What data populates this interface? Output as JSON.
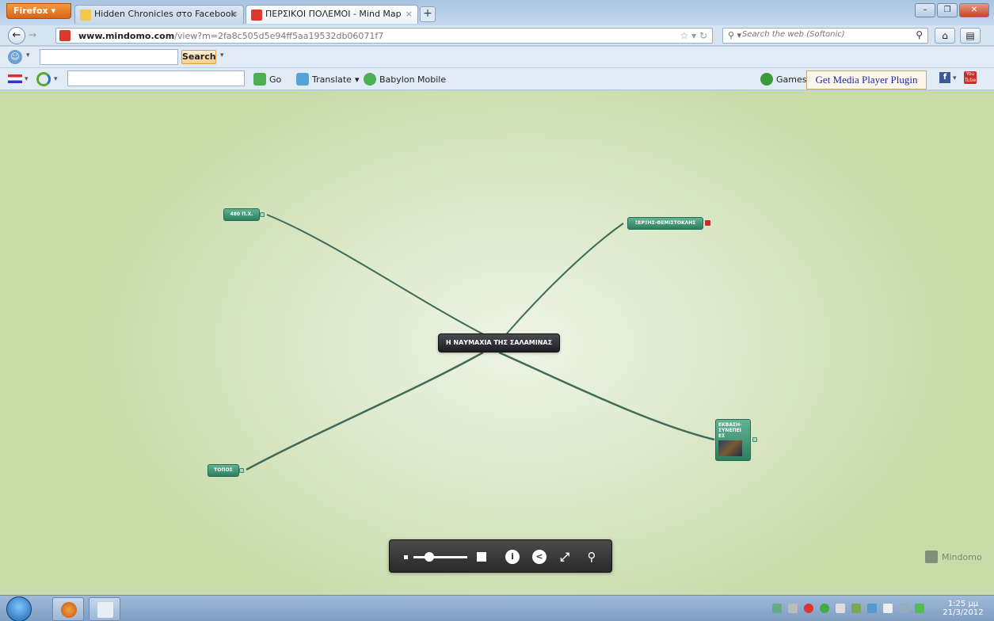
{
  "browser": {
    "app_button": "Firefox",
    "tabs": [
      {
        "label": "Hidden Chronicles στο Facebook",
        "active": false
      },
      {
        "label": "ΠΕΡΣΙΚΟΙ ΠΟΛΕΜΟΙ - Mind Map",
        "active": true
      }
    ],
    "url_domain": "www.mindomo.com",
    "url_path": "/view?m=2fa8c505d5e94ff5aa19532db06071f7",
    "search_placeholder": "Search the web (Softonic)"
  },
  "toolbar1": {
    "search_button": "Search"
  },
  "toolbar2": {
    "go": "Go",
    "translate": "Translate",
    "babylon_mobile": "Babylon Mobile",
    "games": "Games",
    "media_plugin": "Get Media Player Plugin"
  },
  "mindmap": {
    "center": "Η ΝΑΥΜΑΧΙΑ ΤΗΣ ΣΑΛΑΜΙΝΑΣ",
    "nodes": {
      "date": "480 Π.Χ.",
      "people": "ΞΕΡΞΗΣ-ΘΕΜΙΣΤΟΚΛΗΣ",
      "place": "ΤΟΠΟΣ",
      "outcome_lines": [
        "ΕΚΒΑΣΗ-",
        "ΣΥΝΕΠΕΙ",
        "ΕΣ"
      ]
    },
    "brand": "Mindomo",
    "zoom_level": 0.2
  },
  "taskbar": {
    "time": "1:25 μμ",
    "date": "21/3/2012"
  },
  "colors": {
    "canvas_bg": "#d9e7c6",
    "link_line": "#3f6b57",
    "node_green": "#3f9a78",
    "center_node": "#2a2a30"
  }
}
